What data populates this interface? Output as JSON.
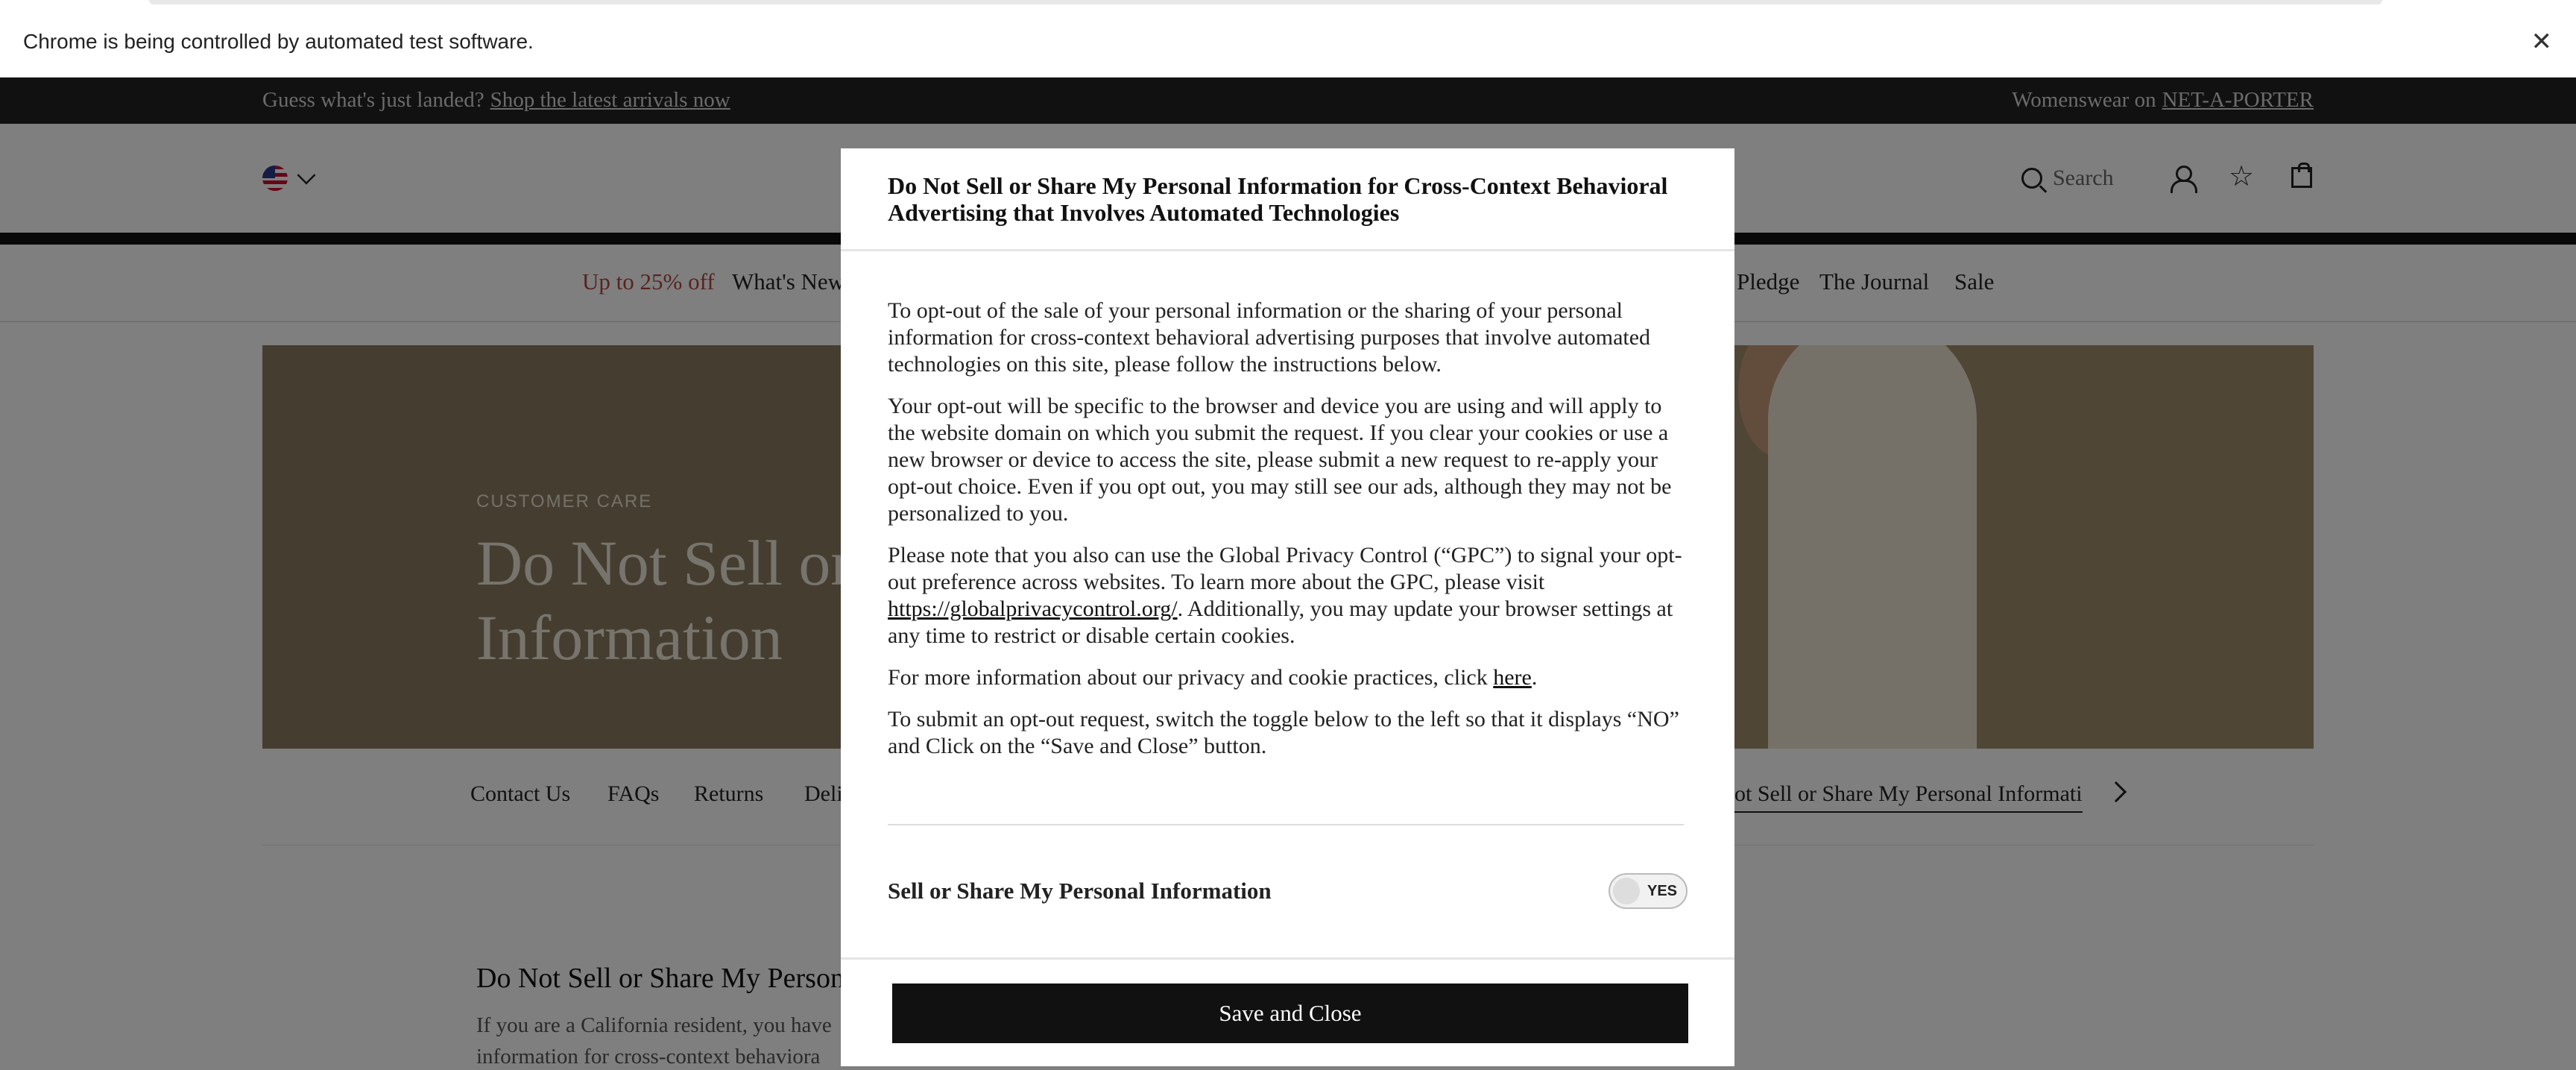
{
  "infobar": {
    "message": "Chrome is being controlled by automated test software.",
    "close_glyph": "✕"
  },
  "promo": {
    "left_text": "Guess what's just landed?",
    "left_link": "Shop the latest arrivals now",
    "right_text": "Womenswear on",
    "right_link": "NET-A-PORTER"
  },
  "header": {
    "search_placeholder": "Search",
    "star_glyph": "☆"
  },
  "nav": {
    "items": [
      "Up to 25% off",
      "What's New",
      "Pledge",
      "The Journal",
      "Sale"
    ]
  },
  "hero": {
    "kicker": "CUSTOMER CARE",
    "title_line1": "Do Not Sell or",
    "title_line2": "Information"
  },
  "subnav": {
    "items": [
      "Contact Us",
      "FAQs",
      "Returns",
      "Deli"
    ],
    "active": "ot Sell or Share My Personal Informati"
  },
  "content": {
    "heading": "Do Not Sell or Share My Person",
    "para_line1": "If you are a California resident, you have",
    "para_line2": "information for cross-context behaviora"
  },
  "modal": {
    "title": "Do Not Sell or Share My Personal Information for Cross-Context Behavioral Advertising that Involves Automated Technologies",
    "p1": "To opt-out of the sale of your personal information or the sharing of your personal information for cross-context behavioral advertising purposes that involve automated technologies on this site, please follow the instructions below.",
    "p2": "Your opt-out will be specific to the browser and device you are using and will apply to the website domain on which you submit the request. If you clear your cookies or use a new browser or device to access the site, please submit a new request to re-apply your opt-out choice. Even if you opt out, you may still see our ads, although they may not be personalized to you.",
    "p3_before": "Please note that you also can use the Global Privacy Control (“GPC”) to signal your opt-out preference across websites. To learn more about the GPC, please visit ",
    "p3_link": "https://globalprivacycontrol.org/",
    "p3_after": ". Additionally, you may update your browser settings at any time to restrict or disable certain cookies.",
    "p4_before": "For more information about our privacy and cookie practices, click ",
    "p4_link": "here",
    "p4_after": ".",
    "p5": "To submit an opt-out request, switch the toggle below to the left so that it displays “NO” and Click on the “Save and Close” button.",
    "pref_label": "Sell or Share My Personal Information",
    "toggle_state": "YES",
    "save_label": "Save and Close"
  }
}
